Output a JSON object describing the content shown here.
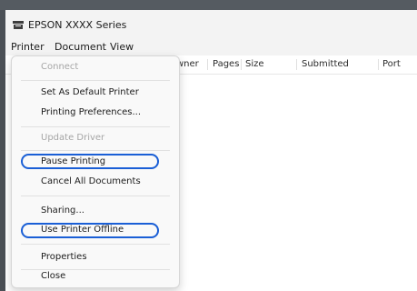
{
  "window": {
    "title": "EPSON XXXX Series",
    "accent_color": "#1a5fd6"
  },
  "menubar": {
    "items": [
      "Printer",
      "Document",
      "View"
    ]
  },
  "table": {
    "headers": [
      "wner",
      "Pages",
      "Size",
      "Submitted",
      "Port"
    ]
  },
  "printer_menu": {
    "items": [
      {
        "label": "Connect",
        "enabled": false
      },
      {
        "label": "Set As Default Printer",
        "enabled": true
      },
      {
        "label": "Printing Preferences...",
        "enabled": true
      },
      {
        "label": "Update Driver",
        "enabled": false
      },
      {
        "label": "Pause Printing",
        "enabled": true,
        "highlighted": true
      },
      {
        "label": "Cancel All Documents",
        "enabled": true
      },
      {
        "label": "Sharing...",
        "enabled": true
      },
      {
        "label": "Use Printer Offline",
        "enabled": true,
        "highlighted": true
      },
      {
        "label": "Properties",
        "enabled": true
      },
      {
        "label": "Close",
        "enabled": true
      }
    ]
  },
  "icons": {
    "app": "printer-icon"
  }
}
